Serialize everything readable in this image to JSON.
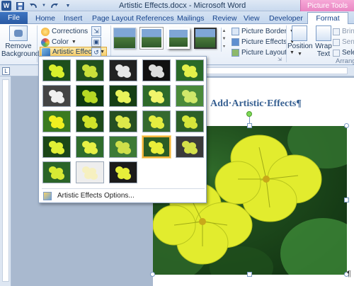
{
  "window": {
    "title": "Artistic Effects.docx - Microsoft Word",
    "context_tab_group": "Picture Tools"
  },
  "qat": {
    "app_icon": "word-logo",
    "save_icon": "save-icon",
    "undo_icon": "undo-icon",
    "redo_icon": "redo-icon",
    "customize_icon": "customize-qat-icon"
  },
  "tabs": [
    {
      "label": "File"
    },
    {
      "label": "Home"
    },
    {
      "label": "Insert"
    },
    {
      "label": "Page Layout"
    },
    {
      "label": "References"
    },
    {
      "label": "Mailings"
    },
    {
      "label": "Review"
    },
    {
      "label": "View"
    },
    {
      "label": "Developer"
    },
    {
      "label": "Format"
    }
  ],
  "ribbon": {
    "remove_background": "Remove Background",
    "corrections": "Corrections",
    "color": "Color",
    "artistic_effects": "Artistic Effects",
    "picture_border": "Picture Border",
    "picture_effects": "Picture Effects",
    "picture_layout": "Picture Layout",
    "position": "Position",
    "wrap_text": "Wrap Text",
    "bring": "Bring",
    "send": "Send",
    "select": "Selec",
    "arrange_label": "Arrange"
  },
  "document": {
    "heading": "Add·Artistic·Effects¶",
    "end_mark": "¶"
  },
  "dropdown": {
    "options_label": "Artistic Effects Options...",
    "selected_index": 18
  },
  "colors": {
    "accent": "#2b5797",
    "context_tab": "#e884c2",
    "selection": "#f0b13b",
    "flower": "#e8ee3a",
    "leaves": "#2f6a2a"
  }
}
